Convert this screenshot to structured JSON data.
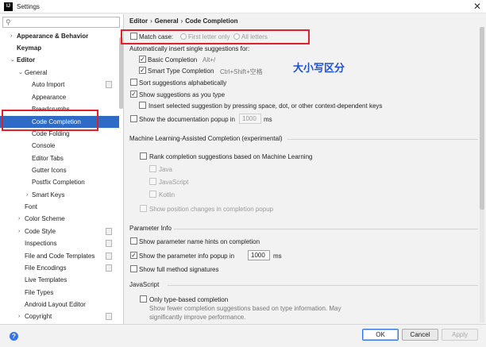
{
  "window": {
    "title": "Settings",
    "app_icon": "IJ",
    "close_glyph": "✕"
  },
  "sidebar": {
    "search": {
      "value": "",
      "placeholder": ""
    },
    "items": [
      {
        "label": "Appearance & Behavior",
        "arrow": "›"
      },
      {
        "label": "Keymap"
      },
      {
        "label": "Editor",
        "arrow": "⌄"
      },
      {
        "label": "General",
        "arrow": "⌄"
      },
      {
        "label": "Auto Import"
      },
      {
        "label": "Appearance"
      },
      {
        "label": "Breadcrumbs"
      },
      {
        "label": "Code Completion"
      },
      {
        "label": "Code Folding"
      },
      {
        "label": "Console"
      },
      {
        "label": "Editor Tabs"
      },
      {
        "label": "Gutter Icons"
      },
      {
        "label": "Postfix Completion"
      },
      {
        "label": "Smart Keys",
        "arrow": "›"
      },
      {
        "label": "Font"
      },
      {
        "label": "Color Scheme",
        "arrow": "›"
      },
      {
        "label": "Code Style",
        "arrow": "›"
      },
      {
        "label": "Inspections"
      },
      {
        "label": "File and Code Templates"
      },
      {
        "label": "File Encodings"
      },
      {
        "label": "Live Templates"
      },
      {
        "label": "File Types"
      },
      {
        "label": "Android Layout Editor"
      },
      {
        "label": "Copyright",
        "arrow": "›"
      }
    ]
  },
  "breadcrumb": {
    "part1": "Editor",
    "part2": "General",
    "part3": "Code Completion",
    "sep": "›"
  },
  "completion": {
    "match_case_label": "Match case:",
    "first_letter_label": "First letter only",
    "all_letters_label": "All letters",
    "auto_insert_title": "Automatically insert single suggestions for:",
    "basic_label": "Basic Completion",
    "basic_shortcut": "Alt+/",
    "smart_label": "Smart Type Completion",
    "smart_shortcut": "Ctrl+Shift+空格",
    "sort_label": "Sort suggestions alphabetically",
    "show_as_you_type_label": "Show suggestions as you type",
    "insert_selected_label": "Insert selected suggestion by pressing space, dot, or other context-dependent keys",
    "doc_popup_label": "Show the documentation popup in",
    "doc_popup_value": "1000",
    "doc_popup_unit": "ms"
  },
  "annotation": {
    "text": "大小写区分"
  },
  "ml": {
    "title": "Machine Learning-Assisted Completion (experimental)",
    "rank_label": "Rank completion suggestions based on Machine Learning",
    "java": "Java",
    "javascript": "JavaScript",
    "kotlin": "Kotlin",
    "show_position_label": "Show position changes in completion popup"
  },
  "param_info": {
    "title": "Parameter Info",
    "name_hints_label": "Show parameter name hints on completion",
    "popup_label": "Show the parameter info popup in",
    "popup_value": "1000",
    "popup_unit": "ms",
    "full_signatures_label": "Show full method signatures"
  },
  "javascript": {
    "title": "JavaScript",
    "type_based_label": "Only type-based completion",
    "desc_line1": "Show fewer completion suggestions based on type information. May",
    "desc_line2": "significantly improve performance."
  },
  "buttons": {
    "ok": "OK",
    "cancel": "Cancel",
    "apply": "Apply",
    "help": "?"
  },
  "colors": {
    "selection": "#2e6bc6",
    "annotation_box": "#e0202a",
    "annotation_text": "#1f4fd6"
  }
}
